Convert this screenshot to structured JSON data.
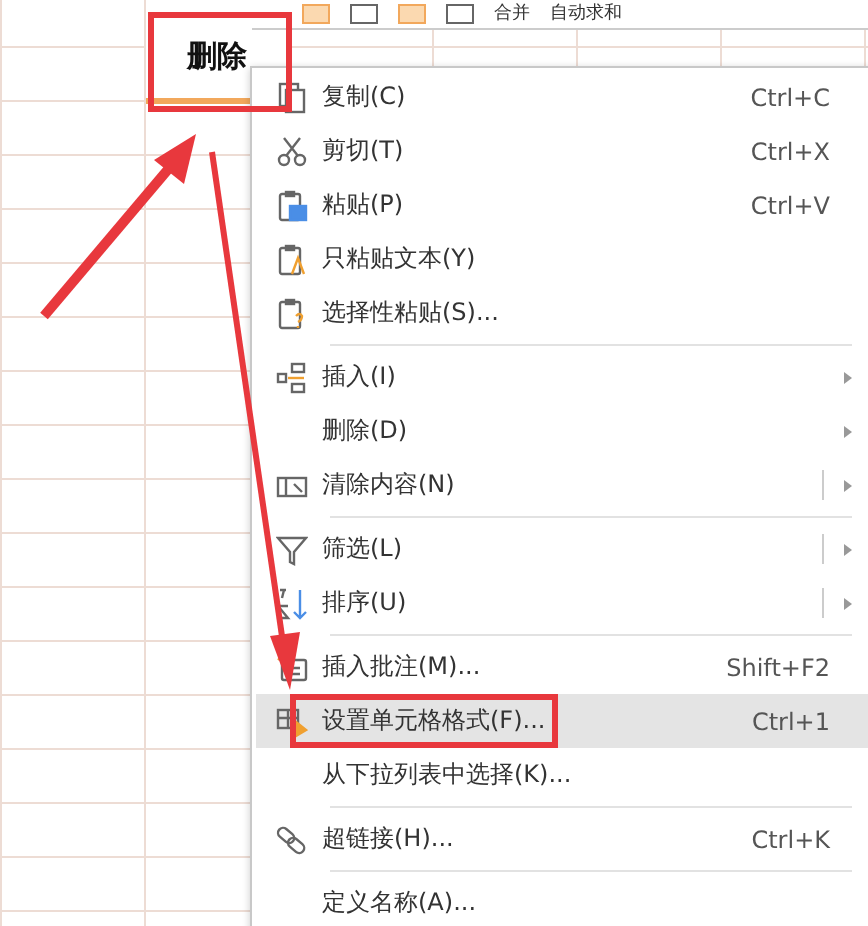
{
  "toolbar": {
    "labels": [
      "合并",
      "自动求和"
    ]
  },
  "cell": {
    "text": "删除"
  },
  "menu": {
    "items": [
      {
        "label": "复制(C)",
        "shortcut": "Ctrl+C",
        "submenu": false,
        "split": false,
        "separator_before": false,
        "selected": false
      },
      {
        "label": "剪切(T)",
        "shortcut": "Ctrl+X",
        "submenu": false,
        "split": false,
        "separator_before": false,
        "selected": false
      },
      {
        "label": "粘贴(P)",
        "shortcut": "Ctrl+V",
        "submenu": false,
        "split": false,
        "separator_before": false,
        "selected": false
      },
      {
        "label": "只粘贴文本(Y)",
        "submenu": false,
        "split": false,
        "separator_before": false,
        "selected": false
      },
      {
        "label": "选择性粘贴(S)...",
        "submenu": false,
        "split": false,
        "separator_before": false,
        "selected": false
      },
      {
        "label": "插入(I)",
        "submenu": true,
        "split": false,
        "separator_before": true,
        "selected": false
      },
      {
        "label": "删除(D)",
        "submenu": true,
        "split": false,
        "separator_before": false,
        "selected": false
      },
      {
        "label": "清除内容(N)",
        "submenu": true,
        "split": true,
        "separator_before": false,
        "selected": false
      },
      {
        "label": "筛选(L)",
        "submenu": true,
        "split": true,
        "separator_before": true,
        "selected": false
      },
      {
        "label": "排序(U)",
        "submenu": true,
        "split": true,
        "separator_before": false,
        "selected": false
      },
      {
        "label": "插入批注(M)...",
        "shortcut": "Shift+F2",
        "submenu": false,
        "split": false,
        "separator_before": true,
        "selected": false
      },
      {
        "label": "设置单元格格式(F)...",
        "shortcut": "Ctrl+1",
        "submenu": false,
        "split": false,
        "separator_before": false,
        "selected": true
      },
      {
        "label": "从下拉列表中选择(K)...",
        "submenu": false,
        "split": false,
        "separator_before": false,
        "selected": false
      },
      {
        "label": "超链接(H)...",
        "shortcut": "Ctrl+K",
        "submenu": false,
        "split": false,
        "separator_before": true,
        "selected": false
      },
      {
        "label": "定义名称(A)...",
        "submenu": false,
        "split": false,
        "separator_before": true,
        "selected": false
      }
    ]
  }
}
